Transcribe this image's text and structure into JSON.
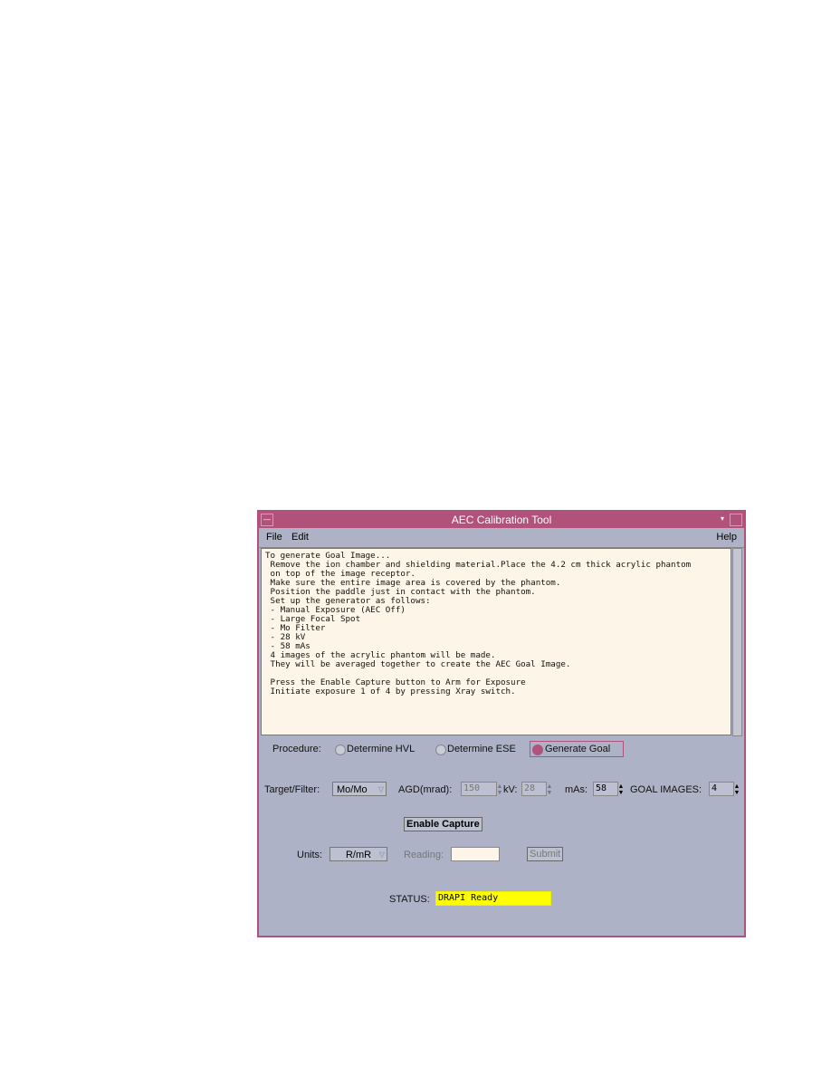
{
  "window": {
    "title": "AEC Calibration Tool",
    "accent": "#b0527a"
  },
  "menu": {
    "file": "File",
    "edit": "Edit",
    "help": "Help"
  },
  "instructions": "To generate Goal Image...\n Remove the ion chamber and shielding material.Place the 4.2 cm thick acrylic phantom\n on top of the image receptor.\n Make sure the entire image area is covered by the phantom.\n Position the paddle just in contact with the phantom.\n Set up the generator as follows:\n - Manual Exposure (AEC Off)\n - Large Focal Spot\n - Mo Filter\n - 28 kV\n - 58 mAs\n 4 images of the acrylic phantom will be made.\n They will be averaged together to create the AEC Goal Image.\n\n Press the Enable Capture button to Arm for Exposure\n Initiate exposure 1 of 4 by pressing Xray switch.",
  "procedure": {
    "label": "Procedure:",
    "options": [
      "Determine HVL",
      "Determine ESE",
      "Generate Goal"
    ],
    "selected": "Generate Goal"
  },
  "settings": {
    "target_filter_label": "Target/Filter:",
    "target_filter": "Mo/Mo",
    "agd_label": "AGD(mrad):",
    "agd": "150",
    "kv_label": "kV:",
    "kv": "28",
    "mas_label": "mAs:",
    "mas": "58",
    "goal_images_label": "GOAL IMAGES:",
    "goal_images": "4"
  },
  "enable_capture": "Enable Capture",
  "units": {
    "label": "Units:",
    "value": "R/mR"
  },
  "reading": {
    "label": "Reading:",
    "value": ""
  },
  "submit": "Submit",
  "status": {
    "label": "STATUS:",
    "value": "DRAPI Ready",
    "color": "#ffff00"
  }
}
